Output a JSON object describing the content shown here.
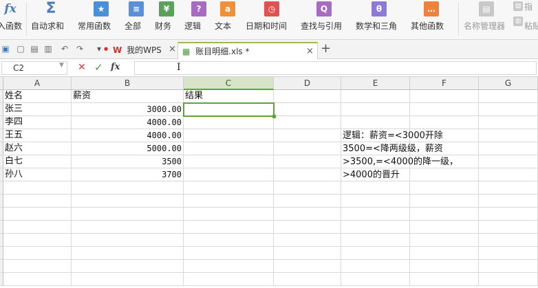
{
  "ribbon": {
    "items": [
      {
        "label": "入函数",
        "icon": "fx-icon",
        "glyph": "fx",
        "color": "#4a7ebb"
      },
      {
        "label": "自动求和",
        "icon": "sigma-icon",
        "glyph": "Σ",
        "color": "#4a7ebb"
      },
      {
        "label": "常用函数",
        "icon": "star-icon",
        "glyph": "★",
        "color": "#4a90d9"
      },
      {
        "label": "全部",
        "icon": "list-icon",
        "glyph": "≡",
        "color": "#5b8fd6"
      },
      {
        "label": "财务",
        "icon": "finance-icon",
        "glyph": "¥",
        "color": "#5ba05b"
      },
      {
        "label": "逻辑",
        "icon": "logic-icon",
        "glyph": "?",
        "color": "#a86bc4"
      },
      {
        "label": "文本",
        "icon": "text-icon",
        "glyph": "a",
        "color": "#f0913a"
      },
      {
        "label": "日期和时间",
        "icon": "clock-icon",
        "glyph": "◷",
        "color": "#e05252"
      },
      {
        "label": "查找与引用",
        "icon": "search-icon",
        "glyph": "Q",
        "color": "#a86bc4"
      },
      {
        "label": "数学和三角",
        "icon": "theta-icon",
        "glyph": "θ",
        "color": "#8c7ad6"
      },
      {
        "label": "其他函数",
        "icon": "more-icon",
        "glyph": "…",
        "color": "#f0813a"
      },
      {
        "label": "名称管理器",
        "icon": "name-manager-icon",
        "glyph": "▤",
        "color": "#c8c8c8"
      },
      {
        "label": "粘贴",
        "icon": "paste-icon",
        "glyph": "▥",
        "color": "#c8c8c8"
      },
      {
        "label": "指",
        "icon": "pointer-icon",
        "glyph": "▧",
        "color": "#c8c8c8"
      }
    ]
  },
  "tabs": {
    "wps_label": "我的WPS",
    "file_label": "账目明细.xls *",
    "close_glyph": "×",
    "add_glyph": "+"
  },
  "formula_bar": {
    "cell_ref": "C2",
    "cancel": "✕",
    "confirm": "✓",
    "fx": "fx",
    "value": ""
  },
  "columns": [
    "A",
    "B",
    "C",
    "D",
    "E",
    "F",
    "G"
  ],
  "selected_column": "C",
  "rows": [
    {
      "a": "姓名",
      "b": "薪资",
      "c": "结果"
    },
    {
      "a": "张三",
      "b": "3000.00",
      "c": ""
    },
    {
      "a": "李四",
      "b": "4000.00",
      "c": ""
    },
    {
      "a": "王五",
      "b": "4000.00",
      "c": ""
    },
    {
      "a": "赵六",
      "b": "5000.00",
      "c": ""
    },
    {
      "a": "白七",
      "b": "3500",
      "c": ""
    },
    {
      "a": "孙八",
      "b": "3700",
      "c": ""
    }
  ],
  "note_lines": [
    "逻辑：薪资=<3000开除",
    "3500=<降两级级，薪资",
    ">3500,=<4000的降一级，",
    ">4000的晋升"
  ]
}
